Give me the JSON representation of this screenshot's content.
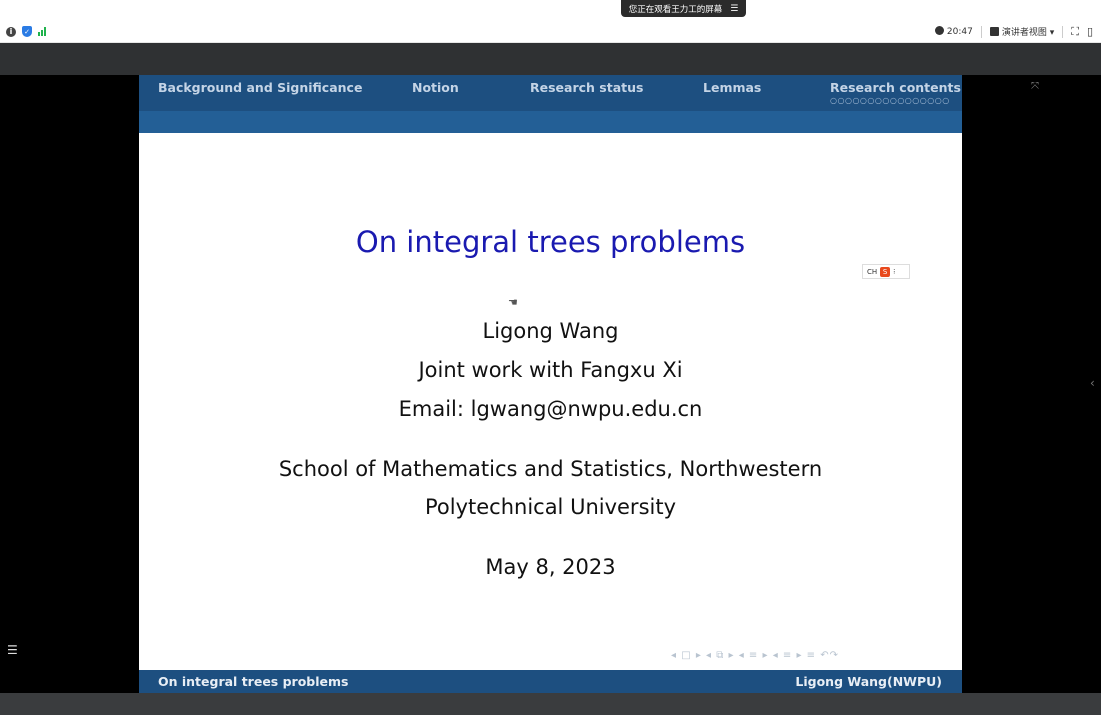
{
  "share_banner": {
    "text": "您正在观看王力工的屏幕",
    "menu_icon": "menu-icon"
  },
  "status_bar": {
    "time": "20:47",
    "presenter_view_label": "演讲者视图 ▾",
    "icons": [
      "info-icon",
      "shield-icon",
      "signal-icon",
      "clock-icon",
      "presenter-view-icon",
      "fullscreen-icon",
      "side-panel-icon"
    ]
  },
  "slide": {
    "nav_sections": [
      "Background and Significance",
      "Notion",
      "Research status",
      "Lemmas",
      "Research contents"
    ],
    "nav_progress_dots": "○○○○○○○○○○○○○○○○",
    "title": "On integral trees problems",
    "author": "Ligong Wang",
    "joint": "Joint work with Fangxu Xi",
    "email": "Email: lgwang@nwpu.edu.cn",
    "institute_line1": "School of Mathematics and Statistics, Northwestern",
    "institute_line2": "Polytechnical University",
    "date": "May 8, 2023",
    "footer_left": "On integral trees problems",
    "footer_right": "Ligong Wang(NWPU)",
    "ime_indicator": "CH",
    "ime_logo": "S",
    "beamer_nav_symbols": "◂ □ ▸ ◂ ⧉ ▸ ◂ ≡ ▸ ◂ ≡ ▸  ≡  ↶↷"
  },
  "colors": {
    "beamer_blue": "#1d4f80",
    "title_blue": "#1a1ab0",
    "stage_black": "#000000"
  }
}
